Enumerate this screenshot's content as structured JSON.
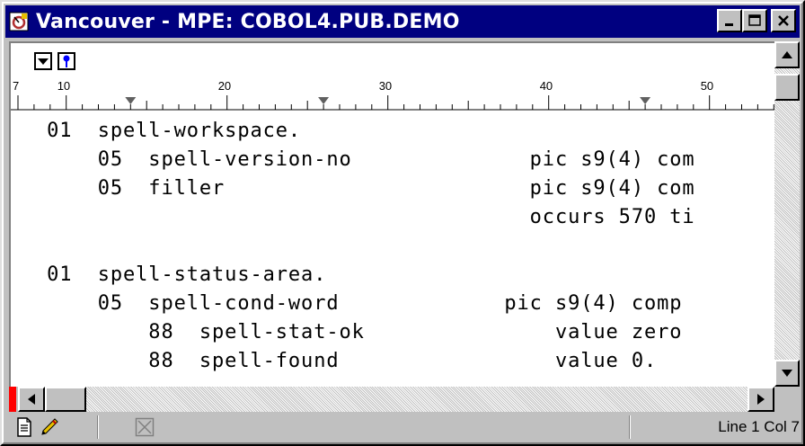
{
  "window": {
    "title": "Vancouver - MPE: COBOL4.PUB.DEMO",
    "app_icon": "vancouver-app-icon"
  },
  "title_buttons": [
    {
      "name": "minimize-button",
      "icon": "minimize-icon"
    },
    {
      "name": "maximize-button",
      "icon": "maximize-icon"
    },
    {
      "name": "close-button",
      "icon": "close-icon"
    }
  ],
  "ruler": {
    "labels": [
      "7",
      "10",
      "20",
      "30",
      "40",
      "50"
    ],
    "tab_stop_icon": "tab-stop-marker-icon",
    "dropdown_icon": "dropdown-arrow-icon",
    "pin_icon": "pin-icon"
  },
  "code_lines": [
    " 01  spell-workspace.",
    "     05  spell-version-no              pic s9(4) com",
    "     05  filler                        pic s9(4) com",
    "                                       occurs 570 ti",
    "",
    " 01  spell-status-area.",
    "     05  spell-cond-word             pic s9(4) comp",
    "         88  spell-stat-ok               value zero",
    "         88  spell-found                 value 0."
  ],
  "statusbar": {
    "position": "Line 1 Col 7",
    "icons": [
      "document-icon",
      "pencil-icon",
      "disabled-x-icon"
    ]
  },
  "colors": {
    "titlebar": "#000080",
    "chrome": "#c0c0c0",
    "marker": "#ff0000"
  }
}
